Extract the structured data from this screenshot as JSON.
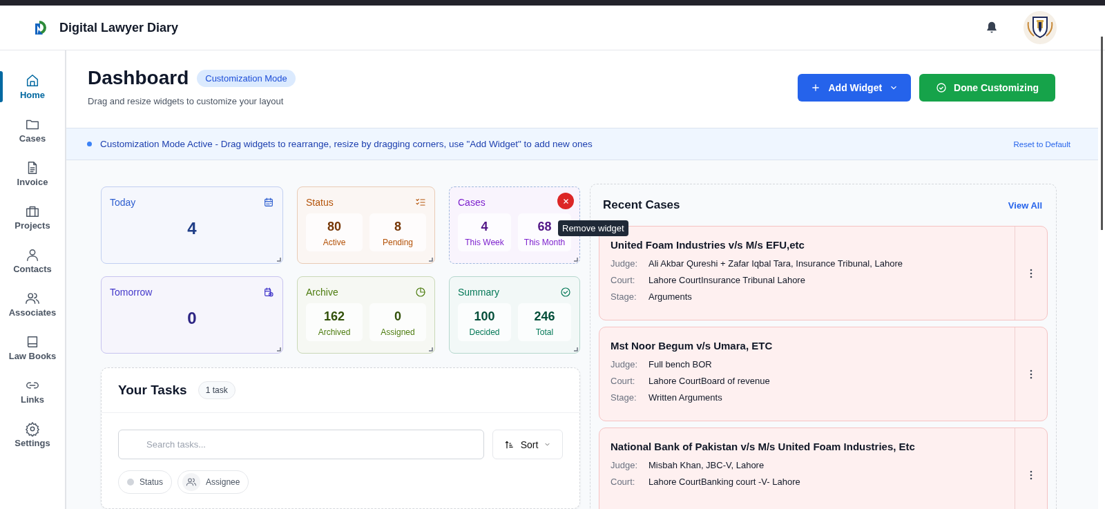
{
  "app": {
    "title": "Digital Lawyer Diary"
  },
  "sidebar": {
    "items": [
      {
        "label": "Home",
        "selected": true
      },
      {
        "label": "Cases",
        "selected": false
      },
      {
        "label": "Invoice",
        "selected": false
      },
      {
        "label": "Projects",
        "selected": false
      },
      {
        "label": "Contacts",
        "selected": false
      },
      {
        "label": "Associates",
        "selected": false
      },
      {
        "label": "Law Books",
        "selected": false
      },
      {
        "label": "Links",
        "selected": false
      },
      {
        "label": "Settings",
        "selected": false
      }
    ]
  },
  "page": {
    "title": "Dashboard",
    "mode_badge": "Customization Mode",
    "subtitle": "Drag and resize widgets to customize your layout",
    "add_button": "Add Widget",
    "done_button": "Done Customizing"
  },
  "banner": {
    "text": "Customization Mode Active - Drag widgets to rearrange, resize by dragging corners, use \"Add Widget\" to add new ones",
    "reset_link": "Reset to Default"
  },
  "widgets": [
    {
      "kind": "single",
      "title": "Today",
      "color": "#2f5fd0",
      "value": "4",
      "selected": false
    },
    {
      "kind": "pair",
      "title": "Status",
      "color": "#b45309",
      "stats": [
        {
          "value": "80",
          "label": "Active"
        },
        {
          "value": "8",
          "label": "Pending"
        }
      ],
      "selected": false
    },
    {
      "kind": "pair",
      "title": "Cases",
      "color": "#7e22ce",
      "stats": [
        {
          "value": "4",
          "label": "This Week"
        },
        {
          "value": "68",
          "label": "This Month"
        }
      ],
      "selected": true,
      "tooltip": "Remove widget"
    },
    {
      "kind": "single",
      "title": "Tomorrow",
      "color": "#4338ca",
      "value": "0",
      "selected": false
    },
    {
      "kind": "pair",
      "title": "Archive",
      "color": "#4d7c0f",
      "stats": [
        {
          "value": "162",
          "label": "Archived"
        },
        {
          "value": "0",
          "label": "Assigned"
        }
      ],
      "selected": false
    },
    {
      "kind": "pair",
      "title": "Summary",
      "color": "#047857",
      "stats": [
        {
          "value": "100",
          "label": "Decided"
        },
        {
          "value": "246",
          "label": "Total"
        }
      ],
      "selected": false
    }
  ],
  "tasks": {
    "title": "Your Tasks",
    "count": "1 task",
    "search": {
      "placeholder": "Search tasks..."
    },
    "sort_button": "Sort",
    "filters": [
      {
        "label": "Status"
      },
      {
        "label": "Assignee"
      }
    ]
  },
  "recent_cases": {
    "title": "Recent Cases",
    "view_all": "View All",
    "cases": [
      {
        "title": "United Foam Industries v/s M/s EFU,etc",
        "fields": [
          {
            "label": "Judge:",
            "value": "Ali Akbar Qureshi + Zafar Iqbal Tara, Insurance Tribunal, Lahore"
          },
          {
            "label": "Court:",
            "value": "Lahore CourtInsurance Tribunal Lahore"
          },
          {
            "label": "Stage:",
            "value": "Arguments"
          }
        ]
      },
      {
        "title": "Mst Noor Begum v/s Umara, ETC",
        "fields": [
          {
            "label": "Judge:",
            "value": "Full bench BOR"
          },
          {
            "label": "Court:",
            "value": "Lahore CourtBoard of revenue"
          },
          {
            "label": "Stage:",
            "value": "Written Arguments"
          }
        ]
      },
      {
        "title": "National Bank of Pakistan v/s M/s United Foam Industries, Etc",
        "fields": [
          {
            "label": "Judge:",
            "value": "Misbah Khan, JBC-V, Lahore"
          },
          {
            "label": "Court:",
            "value": "Lahore CourtBanking court -V- Lahore"
          }
        ]
      }
    ]
  }
}
